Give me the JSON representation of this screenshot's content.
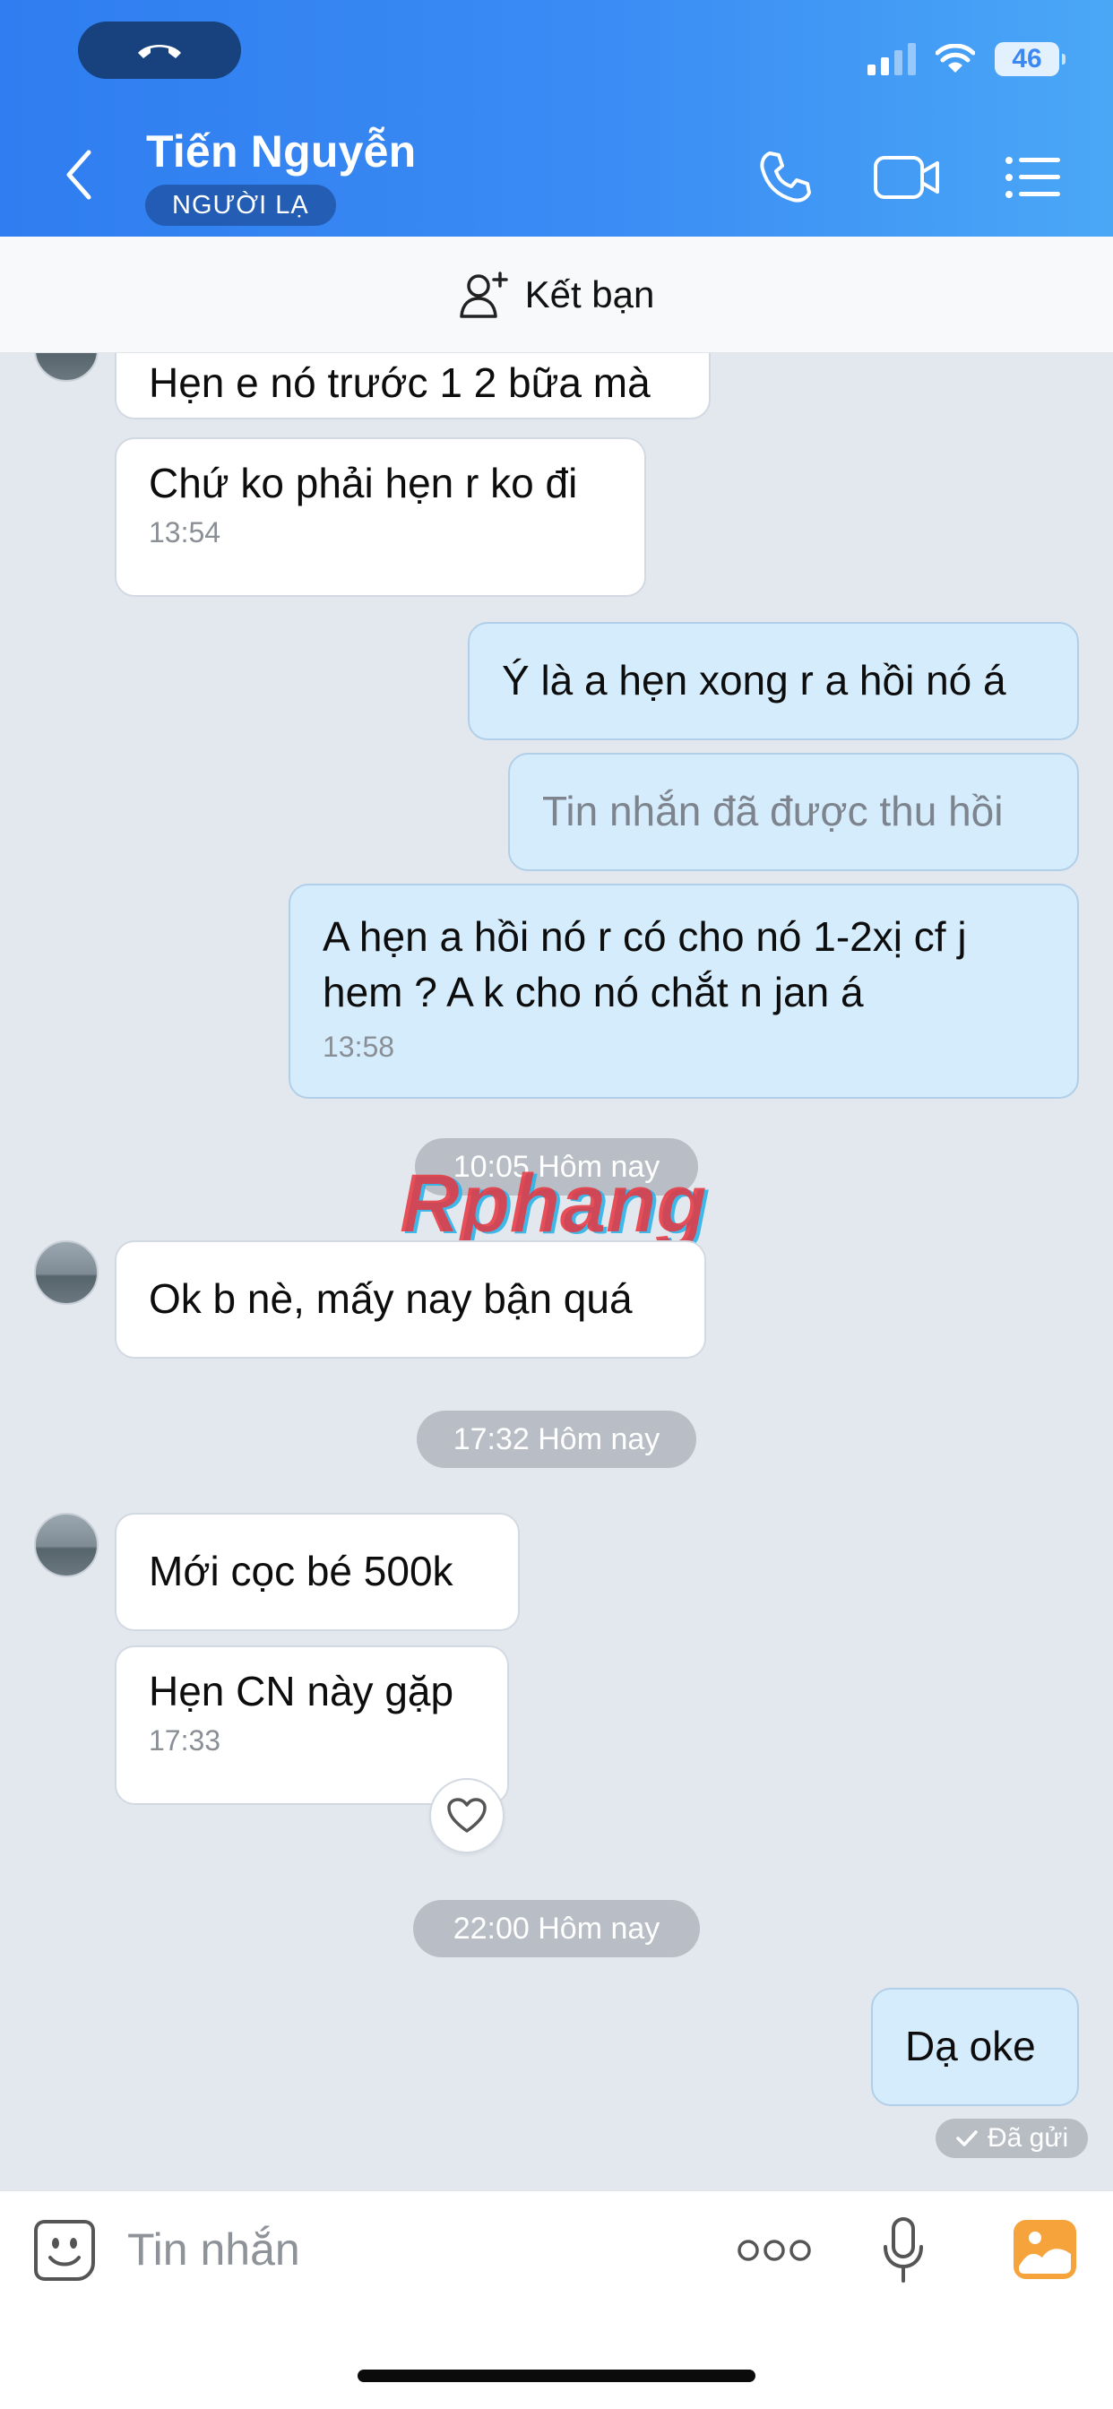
{
  "status_bar": {
    "battery": "46"
  },
  "header": {
    "contact_name": "Tiến Nguyễn",
    "badge": "NGƯỜI LẠ"
  },
  "friend_bar": {
    "label": "Kết bạn"
  },
  "messages": [
    {
      "direction": "in",
      "text": "Hẹn e nó trước 1 2 bữa mà"
    },
    {
      "direction": "in",
      "text": "Chứ ko phải hẹn r ko đi",
      "time": "13:54"
    },
    {
      "direction": "out",
      "text": "Ý là a hẹn xong r a hồi nó á"
    },
    {
      "direction": "out",
      "text": "Tin nhắn đã được thu hồi",
      "recalled": true
    },
    {
      "direction": "out",
      "text_line1": "A hẹn a hồi nó r có cho nó 1-2xị cf j",
      "text_line2": "hem ? A k cho nó chắt n jan á",
      "time": "13:58"
    },
    {
      "direction": "in",
      "text": "Ok b nè, mấy nay bận quá"
    },
    {
      "direction": "in",
      "text": "Mới cọc bé 500k"
    },
    {
      "direction": "in",
      "text": "Hẹn CN này gặp",
      "time": "17:33"
    },
    {
      "direction": "out",
      "text": "Dạ oke"
    }
  ],
  "separators": [
    "10:05 Hôm nay",
    "17:32 Hôm nay",
    "22:00 Hôm nay"
  ],
  "sent_status": "Đã gửi",
  "watermark": "Rphang",
  "input": {
    "placeholder": "Tin nhắn"
  },
  "colors": {
    "header_start": "#2f7df0",
    "header_end": "#4aa7f6",
    "outgoing_bubble": "#d5ecfd",
    "incoming_bubble": "#ffffff",
    "chat_bg": "#e3e8ef",
    "gallery_icon": "#f5a33a"
  },
  "icons": {
    "call_pill": "phone-end-icon",
    "back": "chevron-left-icon",
    "call": "phone-icon",
    "video": "video-camera-icon",
    "menu": "list-menu-icon",
    "add_friend": "add-user-icon",
    "like": "heart-icon",
    "sticker": "sticker-face-icon",
    "more": "more-dots-icon",
    "mic": "microphone-icon",
    "gallery": "gallery-icon",
    "sent": "check-icon"
  }
}
